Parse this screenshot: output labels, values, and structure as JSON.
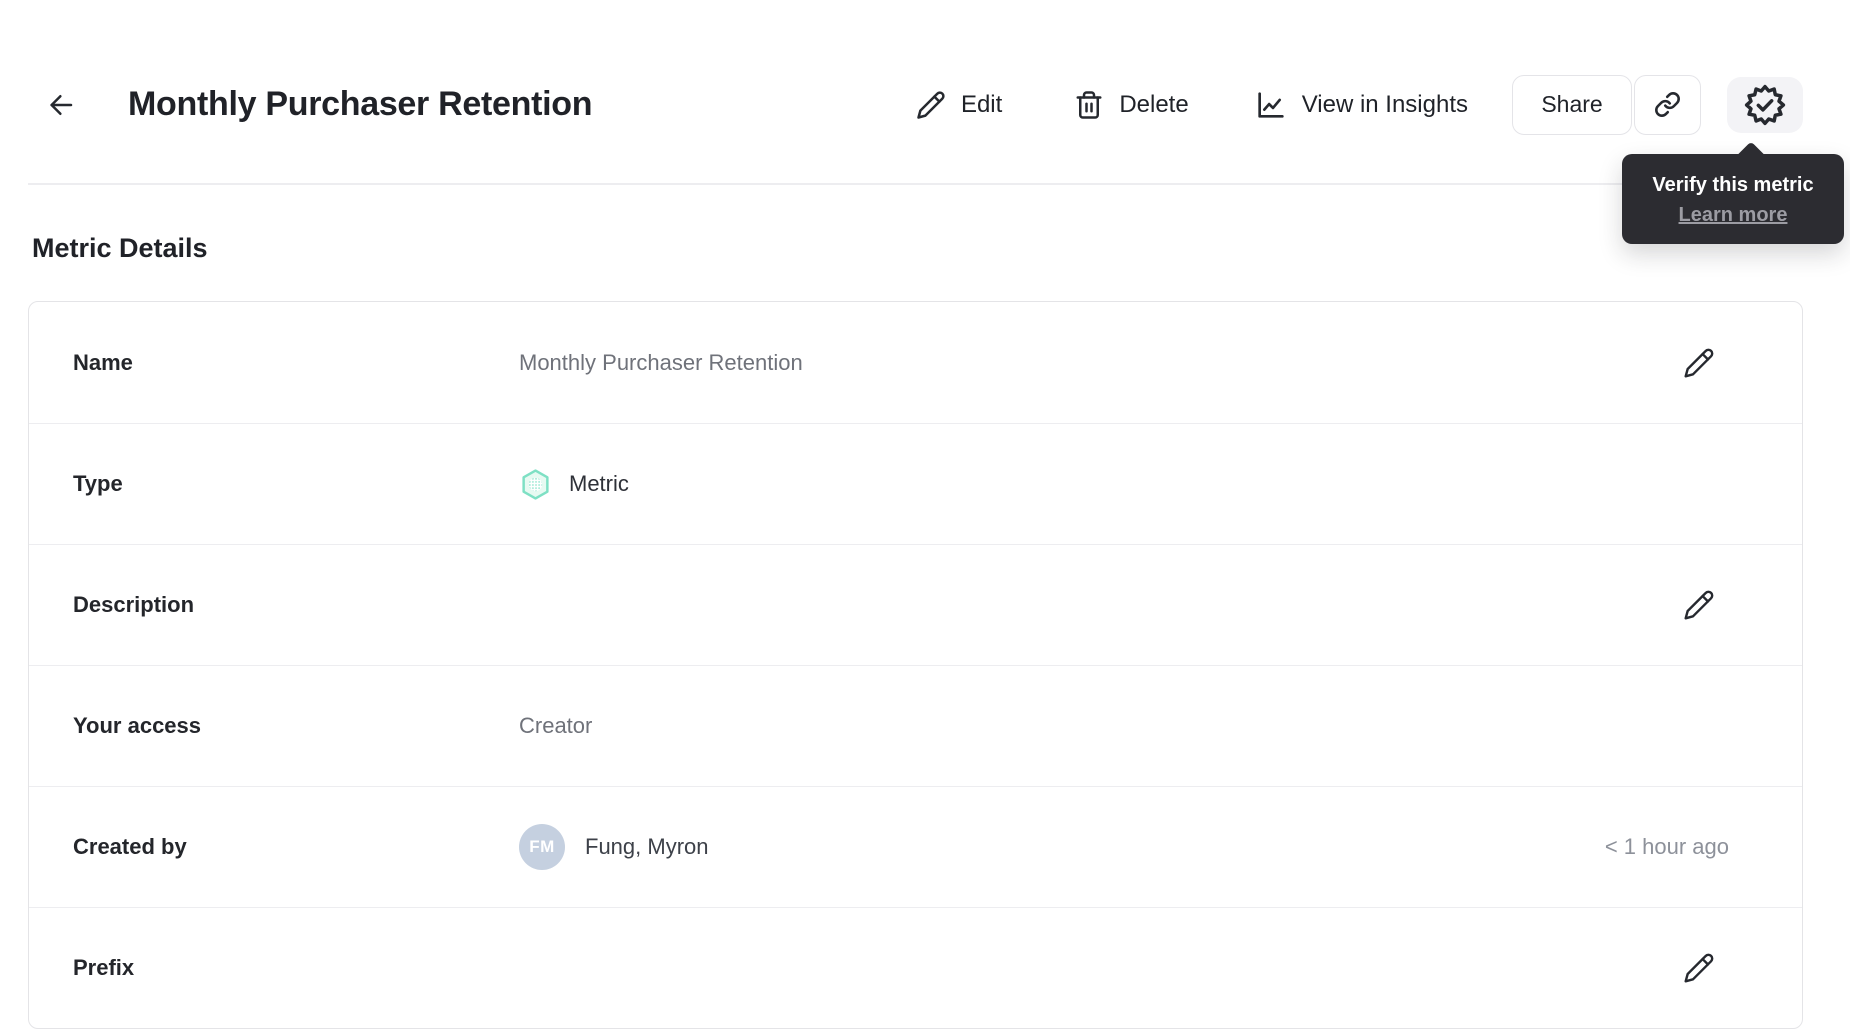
{
  "header": {
    "title": "Monthly Purchaser Retention",
    "actions": {
      "edit": "Edit",
      "delete": "Delete",
      "view_in_insights": "View in Insights",
      "share": "Share"
    }
  },
  "tooltip": {
    "text": "Verify this metric",
    "link_text": "Learn more"
  },
  "section_title": "Metric Details",
  "details": {
    "rows": [
      {
        "label": "Name",
        "value": "Monthly Purchaser Retention"
      },
      {
        "label": "Type",
        "value": "Metric",
        "icon": "metric-hexagon-icon"
      },
      {
        "label": "Description",
        "value": ""
      },
      {
        "label": "Your access",
        "value": "Creator"
      },
      {
        "label": "Created by",
        "value": "Fung, Myron",
        "avatar_initials": "FM",
        "meta": "< 1 hour ago"
      },
      {
        "label": "Prefix",
        "value": ""
      }
    ]
  },
  "colors": {
    "accent_teal": "#7ee0c4",
    "accent_teal_fill": "#e7faf2",
    "tooltip_bg": "#2c2c31",
    "tooltip_link": "#9c9ca3",
    "avatar_bg": "#c5d0e0",
    "text_primary": "#24262b",
    "text_secondary": "#6f727a",
    "border": "#e6e6ea"
  }
}
